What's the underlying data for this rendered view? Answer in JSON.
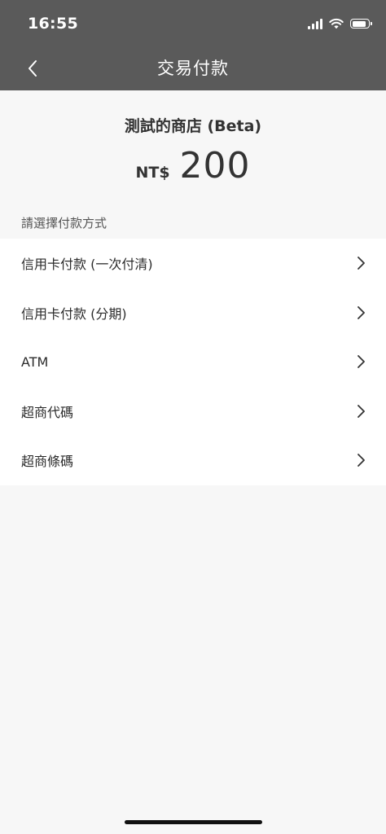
{
  "status_bar": {
    "time": "16:55",
    "icons": [
      "cellular-signal-icon",
      "wifi-icon",
      "battery-icon"
    ]
  },
  "nav": {
    "back_icon": "chevron-left-icon",
    "title": "交易付款"
  },
  "order": {
    "store_name": "測試的商店 (Beta)",
    "currency": "NT$",
    "amount": "200"
  },
  "payment": {
    "section_label": "請選擇付款方式",
    "methods": [
      {
        "label": "信用卡付款 (一次付清)"
      },
      {
        "label": "信用卡付款 (分期)"
      },
      {
        "label": "ATM"
      },
      {
        "label": "超商代碼"
      },
      {
        "label": "超商條碼"
      }
    ]
  },
  "colors": {
    "header_bg": "#5a5a5a",
    "page_bg": "#f7f7f7",
    "list_bg": "#ffffff",
    "text": "#333333"
  }
}
